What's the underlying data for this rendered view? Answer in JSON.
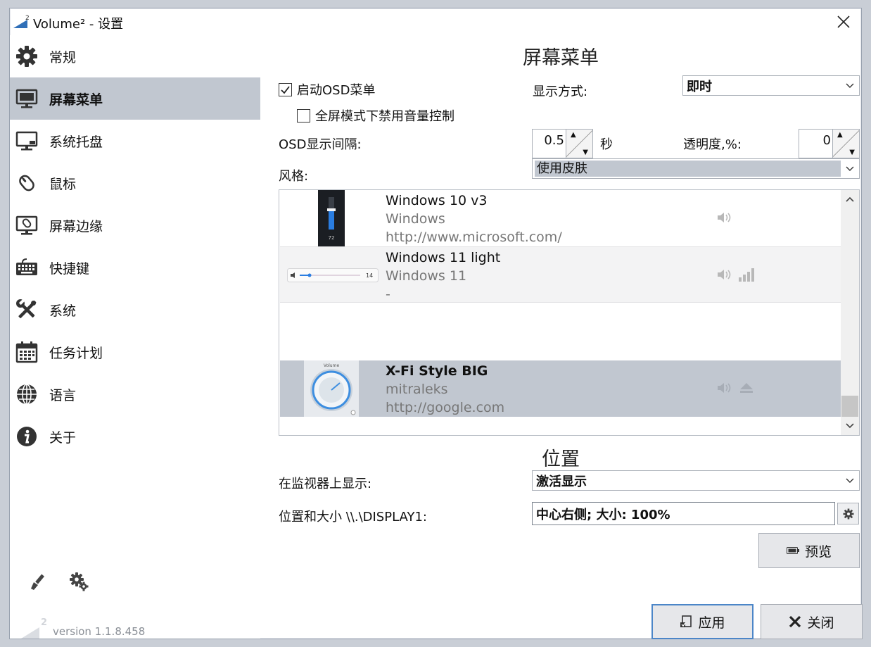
{
  "window": {
    "title": "Volume² - 设置",
    "logo_sup": "2"
  },
  "sidebar": {
    "items": [
      {
        "label": "常规",
        "icon": "gear-icon"
      },
      {
        "label": "屏幕菜单",
        "icon": "monitor-icon"
      },
      {
        "label": "系统托盘",
        "icon": "tray-icon"
      },
      {
        "label": "鼠标",
        "icon": "mouse-icon"
      },
      {
        "label": "屏幕边缘",
        "icon": "screen-edge-icon"
      },
      {
        "label": "快捷键",
        "icon": "keyboard-icon"
      },
      {
        "label": "系统",
        "icon": "tools-icon"
      },
      {
        "label": "任务计划",
        "icon": "calendar-icon"
      },
      {
        "label": "语言",
        "icon": "globe-icon"
      },
      {
        "label": "关于",
        "icon": "info-icon"
      }
    ],
    "active_index": 1,
    "version": "version 1.1.8.458"
  },
  "osd": {
    "section_title": "屏幕菜单",
    "enable_label": "启动OSD菜单",
    "enable_checked": true,
    "fullscreen_label": "全屏模式下禁用音量控制",
    "fullscreen_checked": false,
    "display_mode_label": "显示方式:",
    "display_mode_value": "即时",
    "interval_label": "OSD显示间隔:",
    "interval_value": "0.5",
    "interval_unit": "秒",
    "opacity_label": "透明度,%:",
    "opacity_value": "0",
    "style_label": "风格:",
    "style_value": "使用皮肤",
    "skins": [
      {
        "name": "Windows 10 v3",
        "author": "Windows",
        "url": "http://www.microsoft.com/",
        "thumb_value": "72"
      },
      {
        "name": "Windows 11 light",
        "author": "Windows 11",
        "url": "-",
        "thumb_value": "14"
      },
      {
        "name": "X-Fi Style BIG",
        "author": "mitraleks",
        "url": "http://google.com",
        "thumb_value": "Volume"
      }
    ],
    "selected_skin": 2
  },
  "position": {
    "section_title": "位置",
    "monitor_label": "在监视器上显示:",
    "monitor_value": "激活显示",
    "size_label": "位置和大小 \\\\.\\DISPLAY1:",
    "size_value": "中心右侧; 大小: 100%",
    "preview_label": "预览"
  },
  "footer": {
    "apply_label": "应用",
    "close_label": "关闭"
  },
  "colors": {
    "selection": "#c1c7d0",
    "accent": "#4c86c8"
  }
}
